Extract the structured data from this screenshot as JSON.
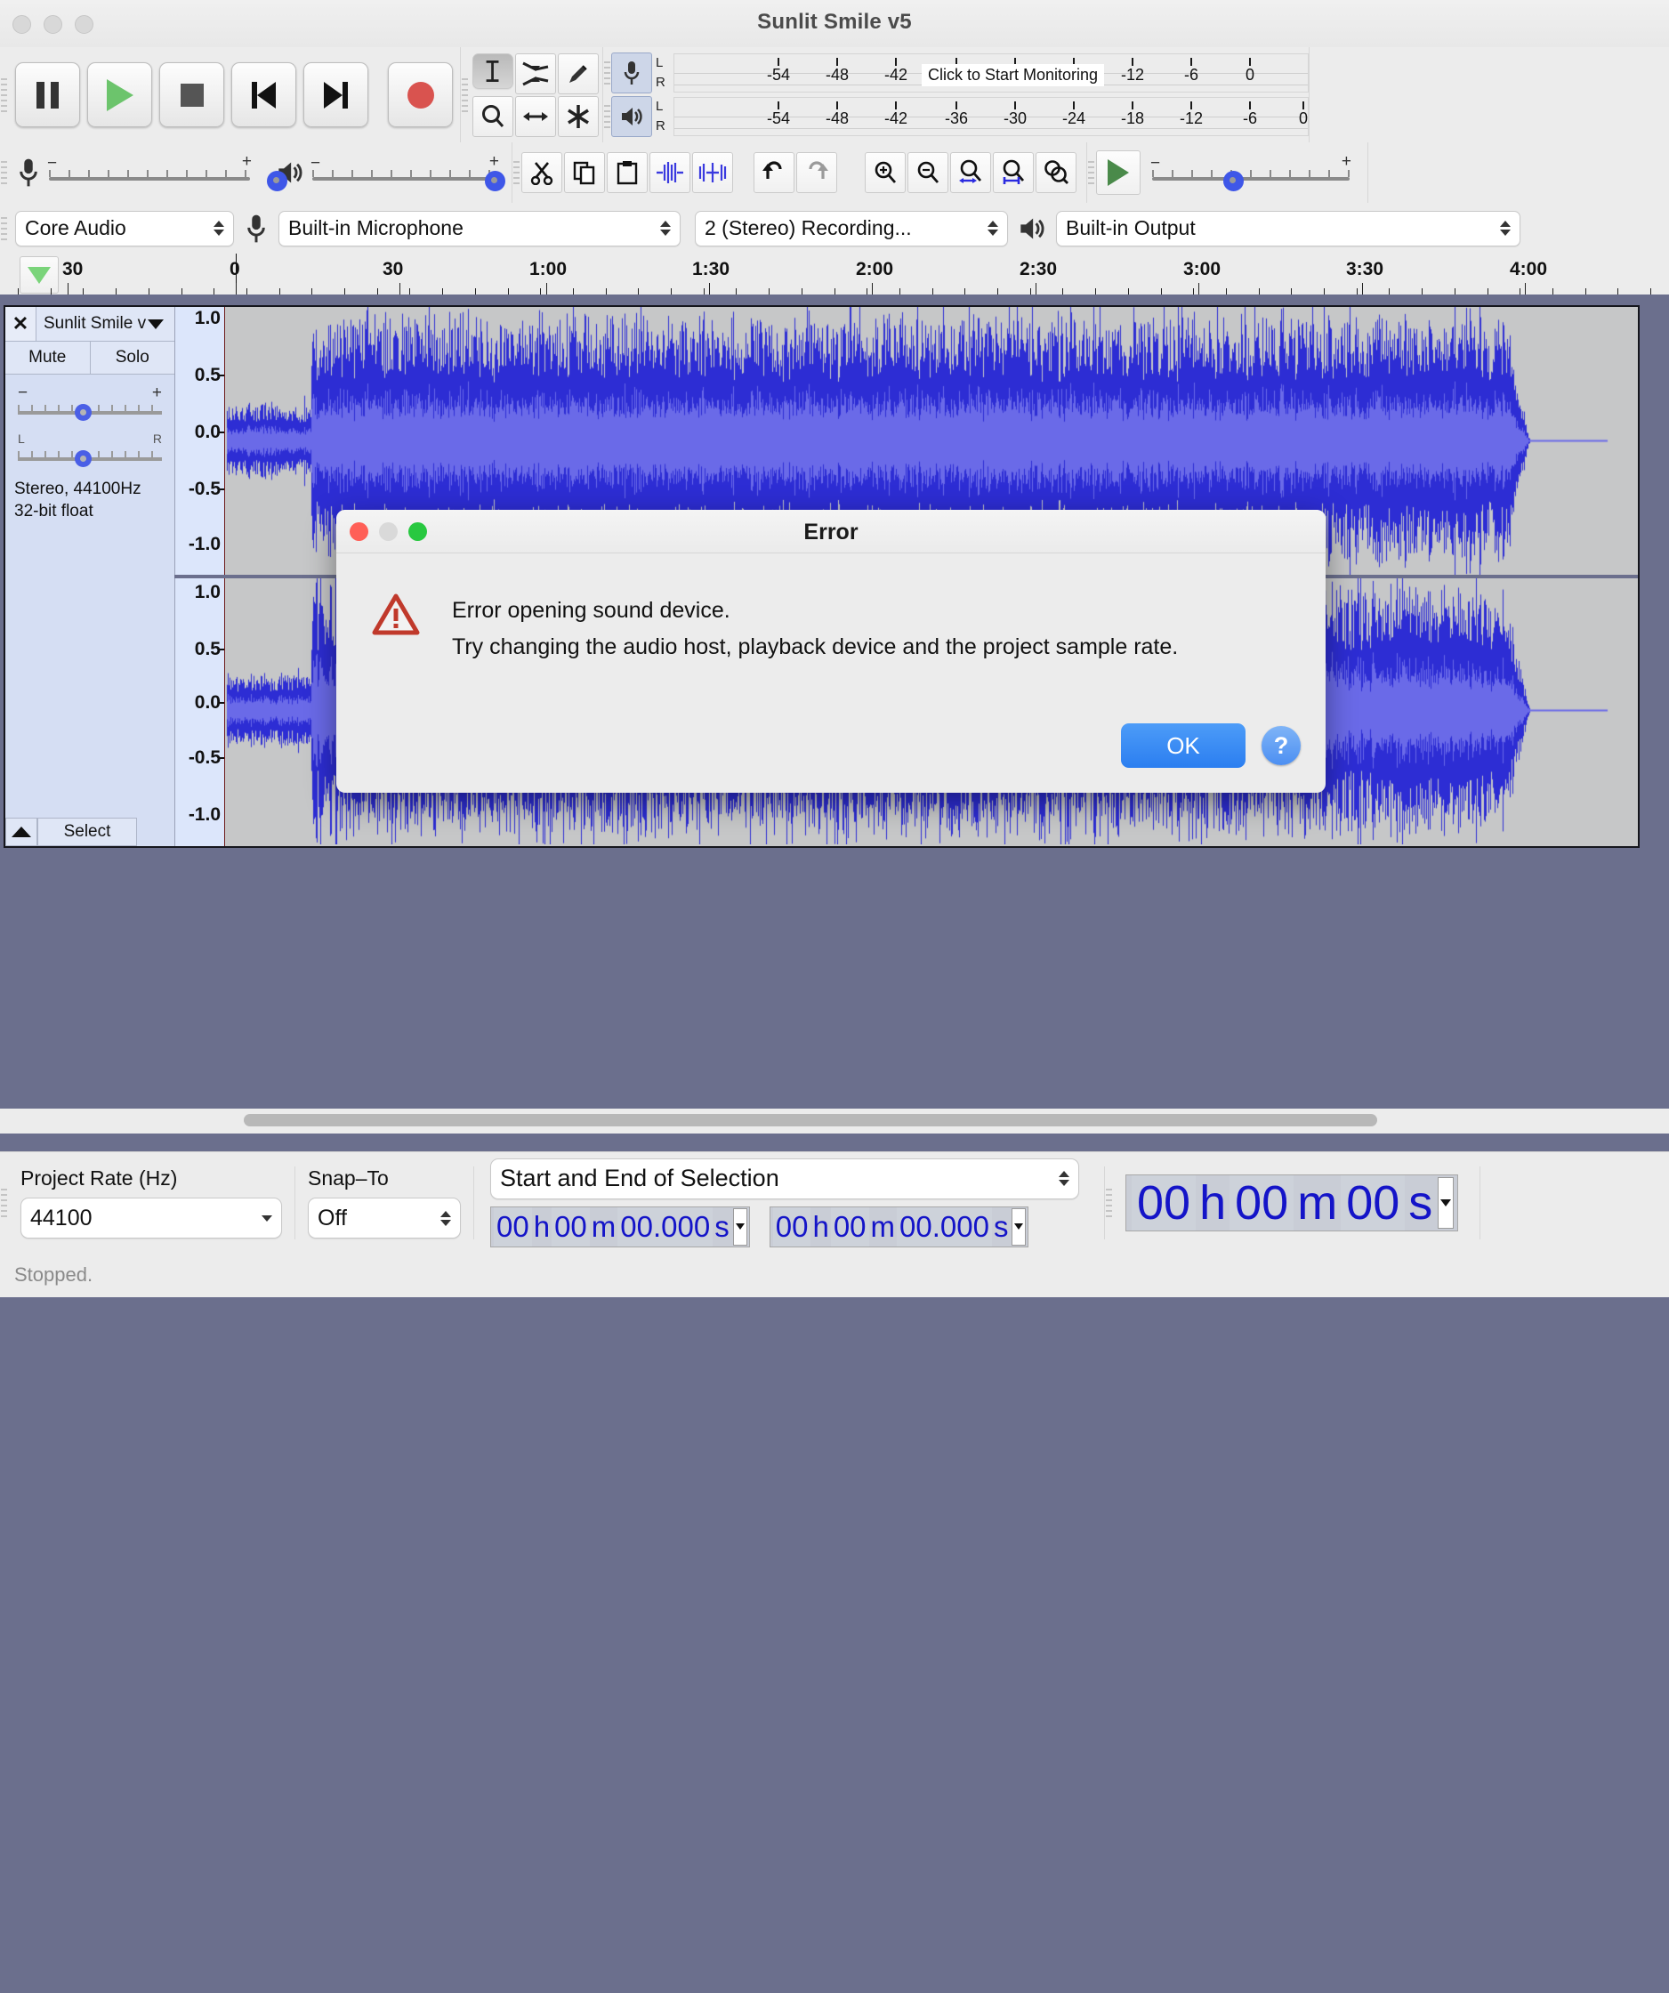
{
  "window": {
    "title": "Sunlit Smile v5"
  },
  "transport": {
    "buttons": [
      {
        "name": "pause",
        "label": "Pause"
      },
      {
        "name": "play",
        "label": "Play"
      },
      {
        "name": "stop",
        "label": "Stop"
      },
      {
        "name": "skip-start",
        "label": "Skip to Start"
      },
      {
        "name": "skip-end",
        "label": "Skip to End"
      },
      {
        "name": "record",
        "label": "Record"
      }
    ]
  },
  "tools": [
    {
      "name": "selection-tool",
      "label": "Selection Tool",
      "selected": true
    },
    {
      "name": "envelope-tool",
      "label": "Envelope Tool",
      "selected": false
    },
    {
      "name": "draw-tool",
      "label": "Draw Tool",
      "selected": false
    },
    {
      "name": "zoom-tool",
      "label": "Zoom Tool",
      "selected": false
    },
    {
      "name": "time-shift-tool",
      "label": "Time Shift Tool",
      "selected": false
    },
    {
      "name": "multi-tool",
      "label": "Multi Tool",
      "selected": false
    }
  ],
  "meters": {
    "record": {
      "channels": [
        "L",
        "R"
      ],
      "ticks": [
        "-54",
        "-48",
        "-42",
        "-18",
        "-12",
        "-6",
        "0"
      ],
      "monitor_hint": "Click to Start Monitoring"
    },
    "play": {
      "channels": [
        "L",
        "R"
      ],
      "ticks": [
        "-54",
        "-48",
        "-42",
        "-36",
        "-30",
        "-24",
        "-18",
        "-12",
        "-6",
        "0"
      ]
    }
  },
  "edit_toolbar": [
    {
      "name": "cut-button",
      "label": "Cut"
    },
    {
      "name": "copy-button",
      "label": "Copy"
    },
    {
      "name": "paste-button",
      "label": "Paste"
    },
    {
      "name": "trim-outside-selection-button",
      "label": "Trim audio outside selection"
    },
    {
      "name": "silence-selection-button",
      "label": "Silence audio selection"
    },
    {
      "name": "undo-button",
      "label": "Undo"
    },
    {
      "name": "redo-button",
      "label": "Redo"
    },
    {
      "name": "zoom-in-button",
      "label": "Zoom In"
    },
    {
      "name": "zoom-out-button",
      "label": "Zoom Out"
    },
    {
      "name": "fit-selection-button",
      "label": "Fit selection to width"
    },
    {
      "name": "fit-project-button",
      "label": "Fit project to width"
    },
    {
      "name": "zoom-toggle-button",
      "label": "Zoom Toggle"
    }
  ],
  "sliders": {
    "recording_volume": {
      "label": "Recording Volume",
      "minus": "−",
      "plus": "+"
    },
    "playback_volume": {
      "label": "Playback Volume",
      "minus": "−",
      "plus": "+"
    },
    "play_speed": {
      "label": "Playback Speed",
      "minus": "−",
      "plus": "+"
    }
  },
  "devices": {
    "audio_host": {
      "label": "Audio Host",
      "value": "Core Audio"
    },
    "recording_device": {
      "label": "Recording Device",
      "value": "Built-in Microphone"
    },
    "recording_channels": {
      "label": "Recording Channels",
      "value": "2 (Stereo) Recording..."
    },
    "playback_device": {
      "label": "Playback Device",
      "value": "Built-in Output"
    }
  },
  "ruler": {
    "labels": [
      "30",
      "0",
      "30",
      "1:00",
      "1:30",
      "2:00",
      "2:30",
      "3:00",
      "3:30",
      "4:00"
    ]
  },
  "track": {
    "name": "Sunlit Smile v",
    "close_label": "✕",
    "mute_label": "Mute",
    "solo_label": "Solo",
    "gain_slider": {
      "minus": "−",
      "plus": "+"
    },
    "pan_slider": {
      "left": "L",
      "right": "R"
    },
    "info_line1": "Stereo, 44100Hz",
    "info_line2": "32-bit float",
    "select_label": "Select",
    "vertical_ruler_labels": [
      "1.0",
      "0.5",
      "0.0",
      "-0.5",
      "-1.0"
    ],
    "waveform_color": "#2d2dd4",
    "waveform_rms_color": "#6a6ae8",
    "track_background": "#c6c7c8"
  },
  "bottom": {
    "project_rate_label": "Project Rate (Hz)",
    "project_rate_value": "44100",
    "snap_to_label": "Snap–To",
    "snap_to_value": "Off",
    "selection_mode": "Start and End of Selection",
    "selection_start": {
      "hh": "00",
      "h": "h",
      "mm": "00",
      "m": "m",
      "ss": "00.000",
      "s": "s"
    },
    "selection_end": {
      "hh": "00",
      "h": "h",
      "mm": "00",
      "m": "m",
      "ss": "00.000",
      "s": "s"
    },
    "audio_position": {
      "hh": "00",
      "h": "h",
      "mm": "00",
      "m": "m",
      "ss": "00",
      "s": "s"
    }
  },
  "status": {
    "text": "Stopped."
  },
  "dialog": {
    "title": "Error",
    "line1": "Error opening sound device.",
    "line2": "Try changing the audio host, playback device and the project sample rate.",
    "ok_label": "OK",
    "help_label": "?"
  }
}
